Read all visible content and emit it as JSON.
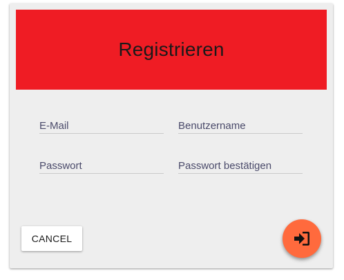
{
  "header": {
    "title": "Registrieren",
    "background_color": "#ef1c24"
  },
  "form": {
    "email": {
      "placeholder": "E-Mail",
      "value": ""
    },
    "username": {
      "placeholder": "Benutzername",
      "value": ""
    },
    "password": {
      "placeholder": "Passwort",
      "value": ""
    },
    "password_confirm": {
      "placeholder": "Passwort bestätigen",
      "value": ""
    }
  },
  "actions": {
    "cancel_label": "CANCEL",
    "submit_icon": "sign-in-icon",
    "submit_color": "#ff6a3d"
  }
}
